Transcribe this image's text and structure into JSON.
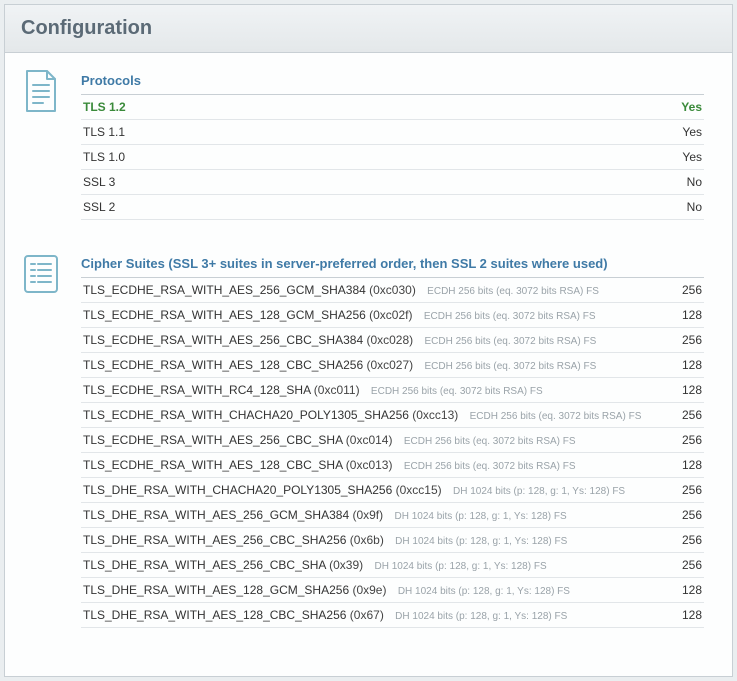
{
  "page_title": "Configuration",
  "protocols": {
    "title": "Protocols",
    "rows": [
      {
        "name": "TLS 1.2",
        "value": "Yes",
        "highlight": true
      },
      {
        "name": "TLS 1.1",
        "value": "Yes",
        "highlight": false
      },
      {
        "name": "TLS 1.0",
        "value": "Yes",
        "highlight": false
      },
      {
        "name": "SSL 3",
        "value": "No",
        "highlight": false
      },
      {
        "name": "SSL 2",
        "value": "No",
        "highlight": false
      }
    ]
  },
  "ciphers": {
    "title": "Cipher Suites (SSL 3+ suites in server-preferred order, then SSL 2 suites where used)",
    "rows": [
      {
        "name": "TLS_ECDHE_RSA_WITH_AES_256_GCM_SHA384",
        "hex": "(0xc030)",
        "ann": "ECDH 256 bits (eq. 3072 bits RSA)   FS",
        "bits": "256"
      },
      {
        "name": "TLS_ECDHE_RSA_WITH_AES_128_GCM_SHA256",
        "hex": "(0xc02f)",
        "ann": "ECDH 256 bits (eq. 3072 bits RSA)   FS",
        "bits": "128"
      },
      {
        "name": "TLS_ECDHE_RSA_WITH_AES_256_CBC_SHA384",
        "hex": "(0xc028)",
        "ann": "ECDH 256 bits (eq. 3072 bits RSA)   FS",
        "bits": "256"
      },
      {
        "name": "TLS_ECDHE_RSA_WITH_AES_128_CBC_SHA256",
        "hex": "(0xc027)",
        "ann": "ECDH 256 bits (eq. 3072 bits RSA)   FS",
        "bits": "128"
      },
      {
        "name": "TLS_ECDHE_RSA_WITH_RC4_128_SHA",
        "hex": "(0xc011)",
        "ann": "ECDH 256 bits (eq. 3072 bits RSA)   FS",
        "bits": "128"
      },
      {
        "name": "TLS_ECDHE_RSA_WITH_CHACHA20_POLY1305_SHA256",
        "hex": "(0xcc13)",
        "ann": "ECDH 256 bits (eq. 3072 bits RSA)   FS",
        "bits": "256"
      },
      {
        "name": "TLS_ECDHE_RSA_WITH_AES_256_CBC_SHA",
        "hex": "(0xc014)",
        "ann": "ECDH 256 bits (eq. 3072 bits RSA)   FS",
        "bits": "256"
      },
      {
        "name": "TLS_ECDHE_RSA_WITH_AES_128_CBC_SHA",
        "hex": "(0xc013)",
        "ann": "ECDH 256 bits (eq. 3072 bits RSA)   FS",
        "bits": "128"
      },
      {
        "name": "TLS_DHE_RSA_WITH_CHACHA20_POLY1305_SHA256",
        "hex": "(0xcc15)",
        "ann": "DH 1024 bits (p: 128, g: 1, Ys: 128)   FS",
        "bits": "256"
      },
      {
        "name": "TLS_DHE_RSA_WITH_AES_256_GCM_SHA384",
        "hex": "(0x9f)",
        "ann": "DH 1024 bits (p: 128, g: 1, Ys: 128)   FS",
        "bits": "256"
      },
      {
        "name": "TLS_DHE_RSA_WITH_AES_256_CBC_SHA256",
        "hex": "(0x6b)",
        "ann": "DH 1024 bits (p: 128, g: 1, Ys: 128)   FS",
        "bits": "256"
      },
      {
        "name": "TLS_DHE_RSA_WITH_AES_256_CBC_SHA",
        "hex": "(0x39)",
        "ann": "DH 1024 bits (p: 128, g: 1, Ys: 128)   FS",
        "bits": "256"
      },
      {
        "name": "TLS_DHE_RSA_WITH_AES_128_GCM_SHA256",
        "hex": "(0x9e)",
        "ann": "DH 1024 bits (p: 128, g: 1, Ys: 128)   FS",
        "bits": "128"
      },
      {
        "name": "TLS_DHE_RSA_WITH_AES_128_CBC_SHA256",
        "hex": "(0x67)",
        "ann": "DH 1024 bits (p: 128, g: 1, Ys: 128)   FS",
        "bits": "128"
      }
    ]
  }
}
